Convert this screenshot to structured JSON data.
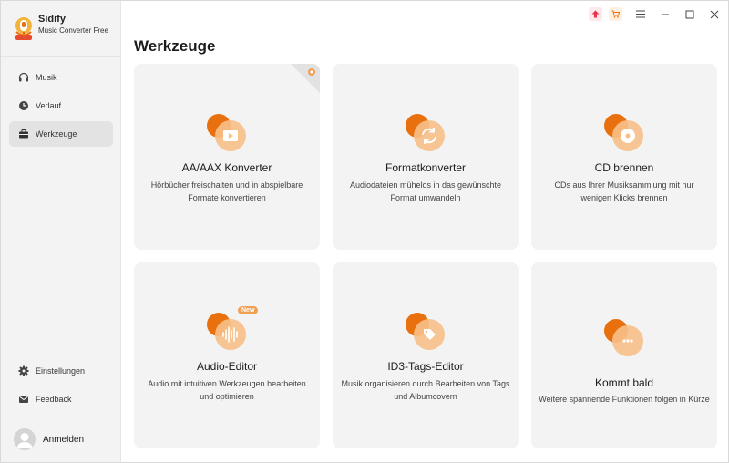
{
  "app": {
    "name": "Sidify",
    "subtitle": "Music Converter Free"
  },
  "sidebar": {
    "items": [
      {
        "label": "Musik",
        "icon": "headphones-icon"
      },
      {
        "label": "Verlauf",
        "icon": "clock-icon"
      },
      {
        "label": "Werkzeuge",
        "icon": "toolbox-icon",
        "active": true
      }
    ],
    "bottom_items": [
      {
        "label": "Einstellungen",
        "icon": "gear-icon"
      },
      {
        "label": "Feedback",
        "icon": "mail-icon"
      }
    ],
    "account_label": "Anmelden"
  },
  "titlebar": {
    "buttons": [
      "upgrade-icon",
      "cart-icon",
      "menu-icon",
      "minimize-icon",
      "maximize-icon",
      "close-icon"
    ]
  },
  "main": {
    "title": "Werkzeuge",
    "cards": [
      {
        "title": "AA/AAX Konverter",
        "desc": "Hörbücher freischalten und in abspielbare Formate konvertieren",
        "icon": "audiobook-play-icon",
        "corner": "premium-corner-icon"
      },
      {
        "title": "Formatkonverter",
        "desc": "Audiodateien mühelos in das gewünschte Format umwandeln",
        "icon": "convert-icon"
      },
      {
        "title": "CD brennen",
        "desc": "CDs aus Ihrer Musiksammlung mit nur wenigen Klicks brennen",
        "icon": "disc-icon"
      },
      {
        "title": "Audio-Editor",
        "desc": "Audio mit intuitiven Werkzeugen bearbeiten und optimieren",
        "icon": "waveform-icon",
        "badge": "New"
      },
      {
        "title": "ID3-Tags-Editor",
        "desc": "Musik organisieren durch Bearbeiten von Tags und Albumcovern",
        "icon": "tag-icon"
      },
      {
        "title": "Kommt bald",
        "desc": "Weitere spannende Funktionen folgen in Kürze",
        "icon": "more-icon"
      }
    ]
  },
  "colors": {
    "accent_orange": "#e8700e",
    "accent_light": "#f7c088",
    "card_bg": "#f3f3f3",
    "sidebar_bg": "#f3f3f3"
  }
}
